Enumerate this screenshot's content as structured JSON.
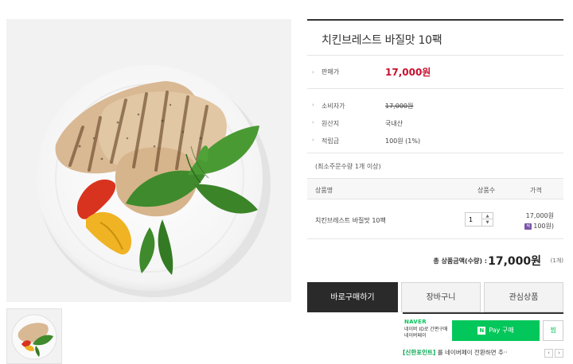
{
  "product": {
    "title": "치킨브레스트 바질맛 10팩",
    "image_alt": "grilled chicken breast with basil and peppers"
  },
  "details": {
    "sale_price_label": "판매가",
    "sale_price": "17,000원",
    "consumer_price_label": "소비자가",
    "consumer_price": "17,000원",
    "origin_label": "원산지",
    "origin": "국내산",
    "points_label": "적립금",
    "points": "100원 (1%)",
    "min_qty": "(최소주문수량 1개 이상)"
  },
  "options": {
    "headers": {
      "name": "상품명",
      "qty": "상품수",
      "price": "가격"
    },
    "rows": [
      {
        "name": "치킨브레스트 바질맛 10팩",
        "qty": "1",
        "price": "17,000원",
        "mileage": "100원)"
      }
    ]
  },
  "total": {
    "label": "총 상품금액(수량) :",
    "amount": "17,000원",
    "count": "(1개)"
  },
  "buttons": {
    "buy": "바로구매하기",
    "cart": "장바구니",
    "wish": "관심상품"
  },
  "npay": {
    "brand": "NAVER",
    "desc_line1": "네이버 ID로 간편구매",
    "desc_line2": "네이버페이",
    "pay_logo": "N",
    "pay_label": "Pay 구매",
    "zzim": "찜",
    "promo_tag": "[신한포인트]",
    "promo_text": "를 네이버페이 전환하면 추··",
    "prev": "‹",
    "next": "›"
  },
  "colors": {
    "accent_price": "#c8102e",
    "naver_green": "#03c75a",
    "buy_button": "#2a2a2a"
  }
}
